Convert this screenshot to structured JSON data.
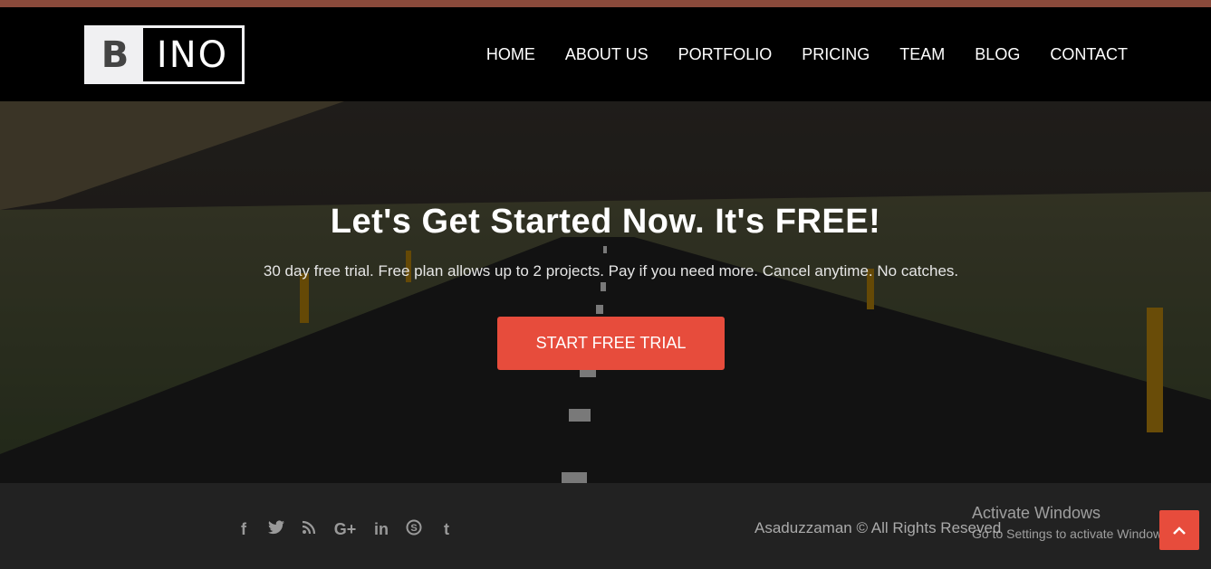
{
  "brand": {
    "logo_left": "B",
    "logo_right": "INO"
  },
  "nav": {
    "items": [
      {
        "label": "HOME"
      },
      {
        "label": "ABOUT US"
      },
      {
        "label": "PORTFOLIO"
      },
      {
        "label": "PRICING"
      },
      {
        "label": "TEAM"
      },
      {
        "label": "BLOG"
      },
      {
        "label": "CONTACT"
      }
    ]
  },
  "hero": {
    "title_light": "Let's Get Started Now.",
    "title_bold": "It's FREE!",
    "subtitle": "30 day free trial. Free plan allows up to 2 projects. Pay if you need more. Cancel anytime. No catches.",
    "cta_label": "START FREE TRIAL"
  },
  "footer": {
    "social_icons": [
      {
        "name": "facebook-icon",
        "glyph": "f"
      },
      {
        "name": "twitter-icon",
        "glyph": "🐦"
      },
      {
        "name": "rss-icon",
        "glyph": "rss"
      },
      {
        "name": "google-plus-icon",
        "glyph": "G+"
      },
      {
        "name": "linkedin-icon",
        "glyph": "in"
      },
      {
        "name": "skype-icon",
        "glyph": "S"
      },
      {
        "name": "tumblr-icon",
        "glyph": "t"
      }
    ],
    "copyright": "Asaduzzaman © All Rights Reseved"
  },
  "watermark": {
    "title": "Activate Windows",
    "subtitle": "Go to Settings to activate Windows."
  },
  "colors": {
    "accent": "#e74c3c",
    "top_strip": "#8a4a3b",
    "nav_bg": "#000000",
    "footer_bg": "#222222"
  }
}
